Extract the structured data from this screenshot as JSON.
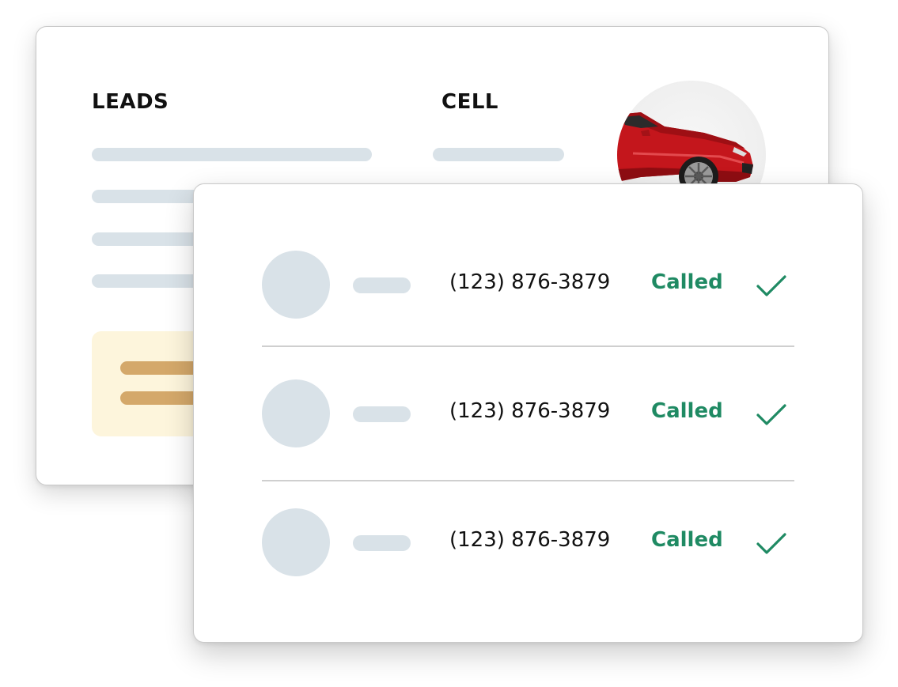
{
  "back_card": {
    "columns": {
      "leads_label": "LEADS",
      "cell_label": "CELL"
    },
    "avatar_icon": "red-car-photo"
  },
  "leads": [
    {
      "phone": "(123) 876-3879",
      "status": "Called",
      "status_icon": "check-icon"
    },
    {
      "phone": "(123) 876-3879",
      "status": "Called",
      "status_icon": "check-icon"
    },
    {
      "phone": "(123) 876-3879",
      "status": "Called",
      "status_icon": "check-icon"
    }
  ],
  "colors": {
    "placeholder_bar": "#d9e2e8",
    "note_background": "#fdf5dc",
    "note_bar": "#d4a86a",
    "status_green": "#1f8a63"
  }
}
